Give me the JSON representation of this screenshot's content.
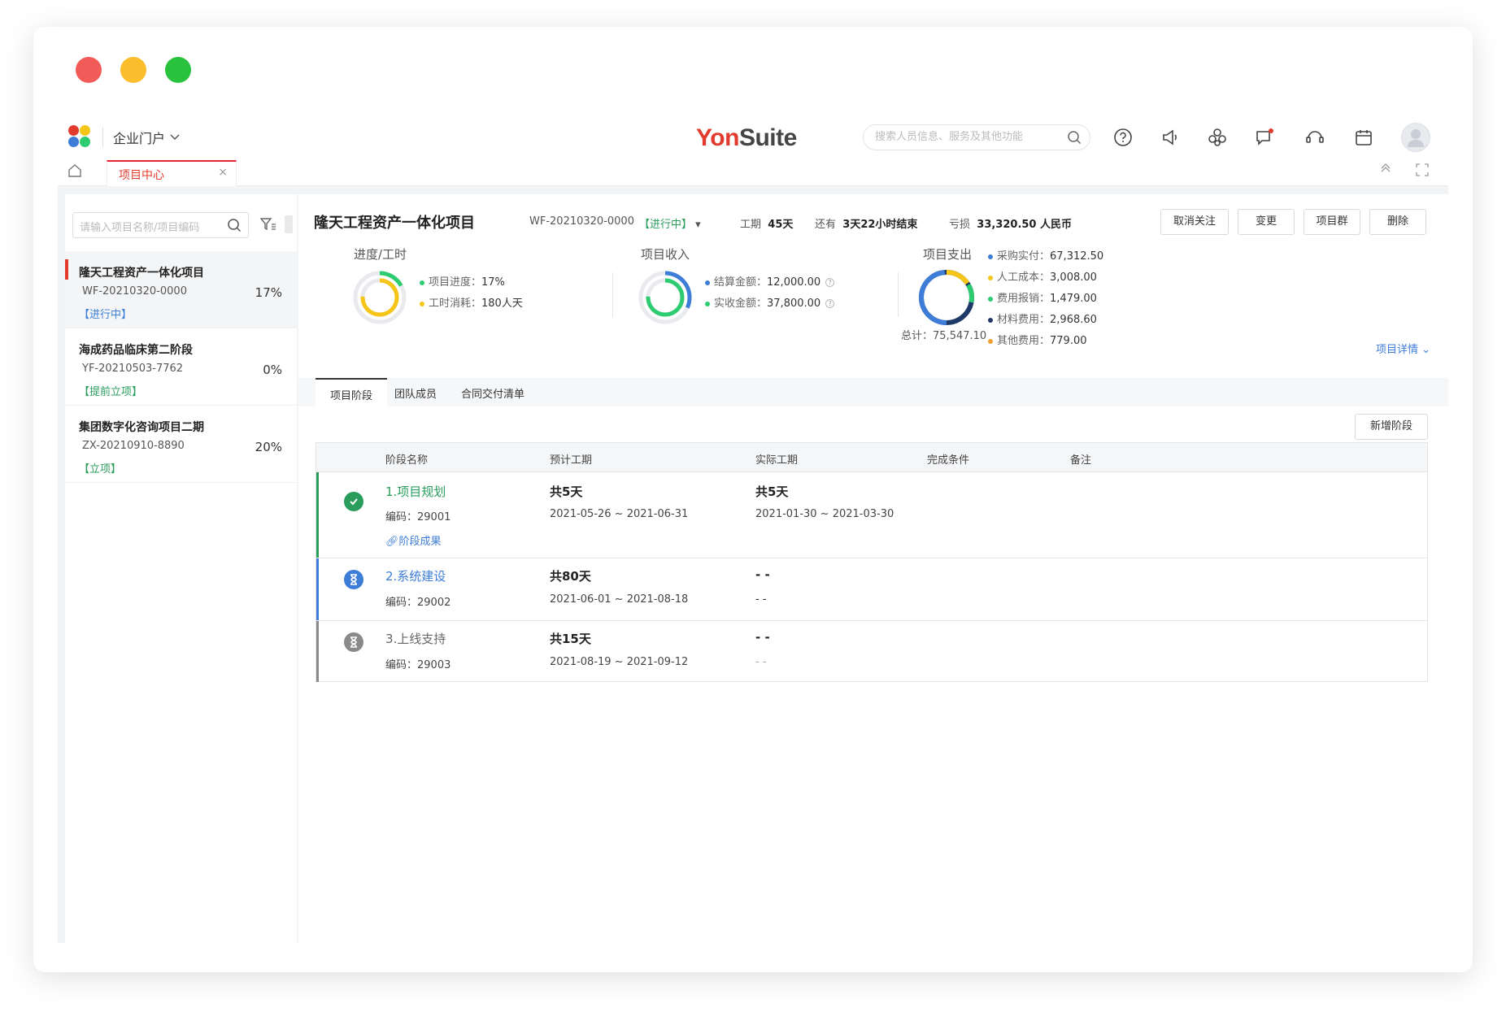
{
  "window": {
    "dots": [
      "#f25b57",
      "#fbbe2c",
      "#29c23d"
    ]
  },
  "header": {
    "portal_label": "企业门户",
    "brand_yon": "Yon",
    "brand_suite": "Suite",
    "search_placeholder": "搜索人员信息、服务及其他功能",
    "icons": [
      "help-icon",
      "megaphone-icon",
      "apps-icon",
      "message-icon",
      "headset-icon",
      "calendar-icon",
      "avatar-icon"
    ]
  },
  "tabs": {
    "home_icon": "home-icon",
    "active_tab": "项目中心",
    "close": "×"
  },
  "sidebar": {
    "search_placeholder": "请输入项目名称/项目编码",
    "items": [
      {
        "name": "隆天工程资产一体化项目",
        "code": "WF-20210320-0000",
        "status": "【进行中】",
        "pct": "17%"
      },
      {
        "name": "海成药品临床第二阶段",
        "code": "YF-20210503-7762",
        "status": "【提前立项】",
        "pct": "0%"
      },
      {
        "name": "集团数字化咨询项目二期",
        "code": "ZX-20210910-8890",
        "status": "【立项】",
        "pct": "20%"
      }
    ]
  },
  "project": {
    "title": "隆天工程资产一体化项目",
    "code": "WF-20210320-0000",
    "status": "【进行中】",
    "period_label": "工期",
    "period_value": "45天",
    "remain_label": "还有",
    "remain_value": "3天22小时结束",
    "loss_label": "亏损",
    "loss_value": "33,320.50 人民币",
    "buttons": [
      "取消关注",
      "变更",
      "项目群",
      "删除"
    ]
  },
  "summary": {
    "progress": {
      "title": "进度/工时",
      "items": [
        {
          "label": "项目进度：",
          "value": "17%",
          "color": "#2ecc71"
        },
        {
          "label": "工时消耗：",
          "value": "180人天",
          "color": "#f5c518"
        }
      ],
      "ring_fraction": 0.17
    },
    "income": {
      "title": "项目收入",
      "items": [
        {
          "label": "结算金额：",
          "value": "12,000.00",
          "color": "#3d7dd8"
        },
        {
          "label": "实收金额：",
          "value": "37,800.00",
          "color": "#2ecc71"
        }
      ]
    },
    "expense": {
      "title": "项目支出",
      "items": [
        {
          "label": "采购实付：",
          "value": "67,312.50",
          "color": "#3d7dd8"
        },
        {
          "label": "人工成本：",
          "value": "3,008.00",
          "color": "#f5c518"
        },
        {
          "label": "费用报销：",
          "value": "1,479.00",
          "color": "#2ecc71"
        },
        {
          "label": "材料费用：",
          "value": "2,968.60",
          "color": "#1f3a68"
        },
        {
          "label": "其他费用：",
          "value": "779.00",
          "color": "#f0a030"
        }
      ],
      "total_label": "总计：",
      "total_value": "75,547.10"
    },
    "detail_link": "项目详情"
  },
  "subtabs": [
    "项目阶段",
    "团队成员",
    "合同交付清单"
  ],
  "add_stage": "新增阶段",
  "table": {
    "headers": [
      "阶段名称",
      "预计工期",
      "实际工期",
      "完成条件",
      "备注"
    ],
    "rows": [
      {
        "name": "1.项目规划",
        "code_label": "编码：",
        "code": "29001",
        "link": "阶段成果",
        "plan_dur": "共5天",
        "plan_range": "2021-05-26 ~ 2021-06-31",
        "actual_dur": "共5天",
        "actual_range": "2021-01-30 ~ 2021-03-30",
        "state": "done"
      },
      {
        "name": "2.系统建设",
        "code_label": "编码：",
        "code": "29002",
        "plan_dur": "共80天",
        "plan_range": "2021-06-01 ~ 2021-08-18",
        "actual_dur": "- -",
        "actual_range": "- -",
        "state": "active"
      },
      {
        "name": "3.上线支持",
        "code_label": "编码：",
        "code": "29003",
        "plan_dur": "共15天",
        "plan_range": "2021-08-19 ~ 2021-09-12",
        "actual_dur": "- -",
        "actual_range": "- -",
        "state": "pending"
      }
    ]
  }
}
